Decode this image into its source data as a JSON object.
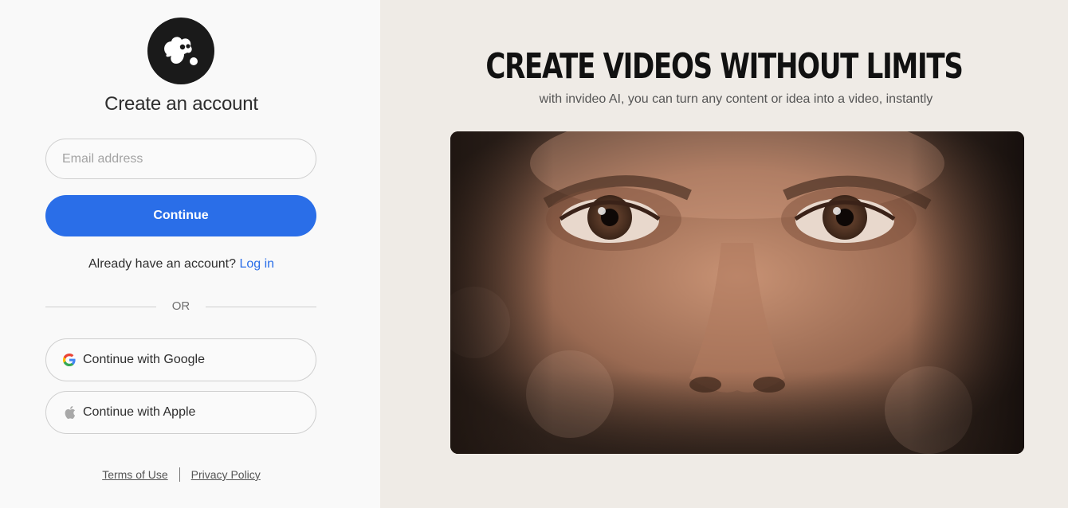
{
  "auth": {
    "title": "Create an account",
    "email_placeholder": "Email address",
    "continue_label": "Continue",
    "have_account_text": "Already have an account?",
    "login_label": "Log in",
    "or_label": "OR",
    "google_label": "Continue with Google",
    "apple_label": "Continue with Apple",
    "terms_label": "Terms of Use",
    "privacy_label": "Privacy Policy"
  },
  "promo": {
    "headline": "CREATE VIDEOS WITHOUT LIMITS",
    "subline": "with invideo AI, you can turn any content or idea into a video, instantly"
  },
  "colors": {
    "accent": "#2a6ee8",
    "left_bg": "#f9f9f9",
    "right_bg": "#efebe6",
    "logo_bg": "#1a1a1a"
  },
  "icons": {
    "logo": "invideo-logo-icon",
    "google": "google-icon",
    "apple": "apple-icon"
  }
}
